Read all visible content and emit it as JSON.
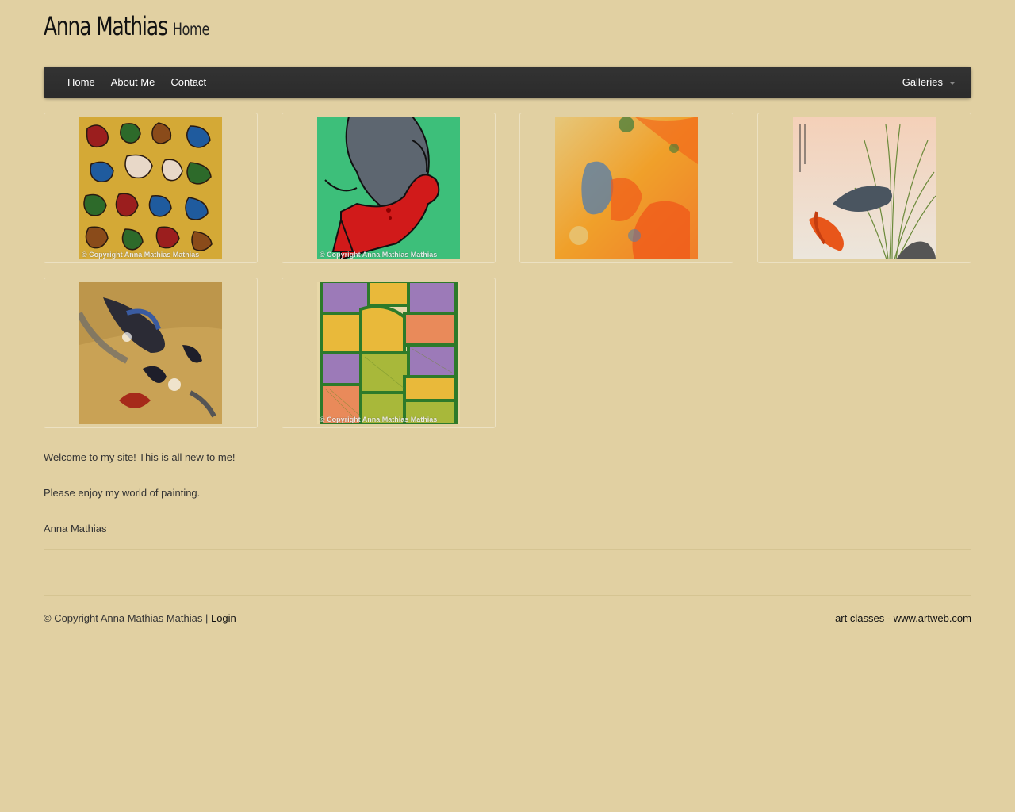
{
  "header": {
    "site_title": "Anna Mathias",
    "page_subtitle": "Home"
  },
  "nav": {
    "items": [
      {
        "label": "Home"
      },
      {
        "label": "About Me"
      },
      {
        "label": "Contact"
      }
    ],
    "galleries_label": "Galleries"
  },
  "gallery": {
    "items": [
      {
        "watermark": "© Copyright Anna Mathias Mathias"
      },
      {
        "watermark": "© Copyright Anna Mathias Mathias"
      },
      {
        "watermark": ""
      },
      {
        "watermark": ""
      },
      {
        "watermark": ""
      },
      {
        "watermark": "© Copyright Anna Mathias Mathias"
      }
    ]
  },
  "content": {
    "paragraphs": [
      "Welcome to my site! This is all new to me!",
      "Please enjoy my world of painting.",
      "Anna Mathias"
    ]
  },
  "footer": {
    "copyright": "© Copyright Anna Mathias Mathias |",
    "login_label": "Login",
    "credit": "art classes - www.artweb.com"
  },
  "colors": {
    "background": "#e1d0a2",
    "navbar": "#2e2e2e"
  }
}
